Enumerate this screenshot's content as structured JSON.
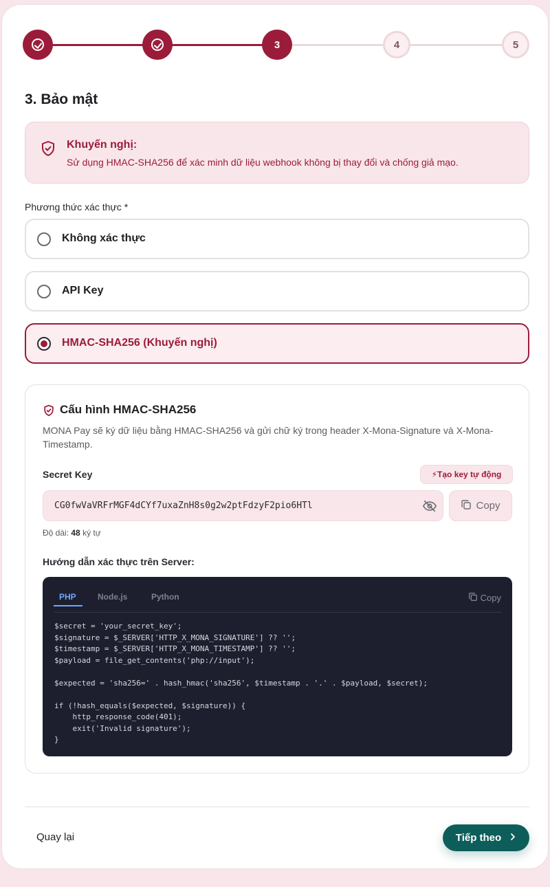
{
  "stepper": {
    "steps": [
      {
        "label": "",
        "state": "done"
      },
      {
        "label": "",
        "state": "done"
      },
      {
        "label": "3",
        "state": "active"
      },
      {
        "label": "4",
        "state": "todo"
      },
      {
        "label": "5",
        "state": "todo"
      }
    ]
  },
  "section": {
    "title": "3. Bảo mật"
  },
  "notice": {
    "title": "Khuyến nghị:",
    "text": "Sử dụng HMAC-SHA256 để xác minh dữ liệu webhook không bị thay đổi và chống giả mạo."
  },
  "auth": {
    "label": "Phương thức xác thực *",
    "options": [
      {
        "label": "Không xác thực",
        "selected": false
      },
      {
        "label": "API Key",
        "selected": false
      },
      {
        "label": "HMAC-SHA256 (Khuyến nghị)",
        "selected": true
      }
    ]
  },
  "config": {
    "title": "Cấu hình HMAC-SHA256",
    "description": "MONA Pay sẽ ký dữ liệu bằng HMAC-SHA256 và gửi chữ ký trong header X-Mona-Signature và X-Mona-Timestamp.",
    "secret_key_label": "Secret Key",
    "generate_label": "⚡Tạo key tự động",
    "secret_key_value": "CG0fwVaVRFrMGF4dCYf7uxaZnH8s0g2w2ptFdzyF2pio6HTl",
    "copy_label": "Copy",
    "length_prefix": "Độ dài:",
    "length_value": "48",
    "length_suffix": "ký tự",
    "guide_title": "Hướng dẫn xác thực trên Server:",
    "code": {
      "tabs": [
        "PHP",
        "Node.js",
        "Python"
      ],
      "active_tab": "PHP",
      "copy_label": "Copy",
      "snippet": "$secret = 'your_secret_key';\n$signature = $_SERVER['HTTP_X_MONA_SIGNATURE'] ?? '';\n$timestamp = $_SERVER['HTTP_X_MONA_TIMESTAMP'] ?? '';\n$payload = file_get_contents('php://input');\n\n$expected = 'sha256=' . hash_hmac('sha256', $timestamp . '.' . $payload, $secret);\n\nif (!hash_equals($expected, $signature)) {\n    http_response_code(401);\n    exit('Invalid signature');\n}"
    }
  },
  "footer": {
    "back_label": "Quay lại",
    "next_label": "Tiếp theo"
  },
  "colors": {
    "primary": "#9b1c3a",
    "accent_bg": "#f9e6ea",
    "next_button": "#0d5e5a",
    "code_bg": "#1e1f2e"
  }
}
